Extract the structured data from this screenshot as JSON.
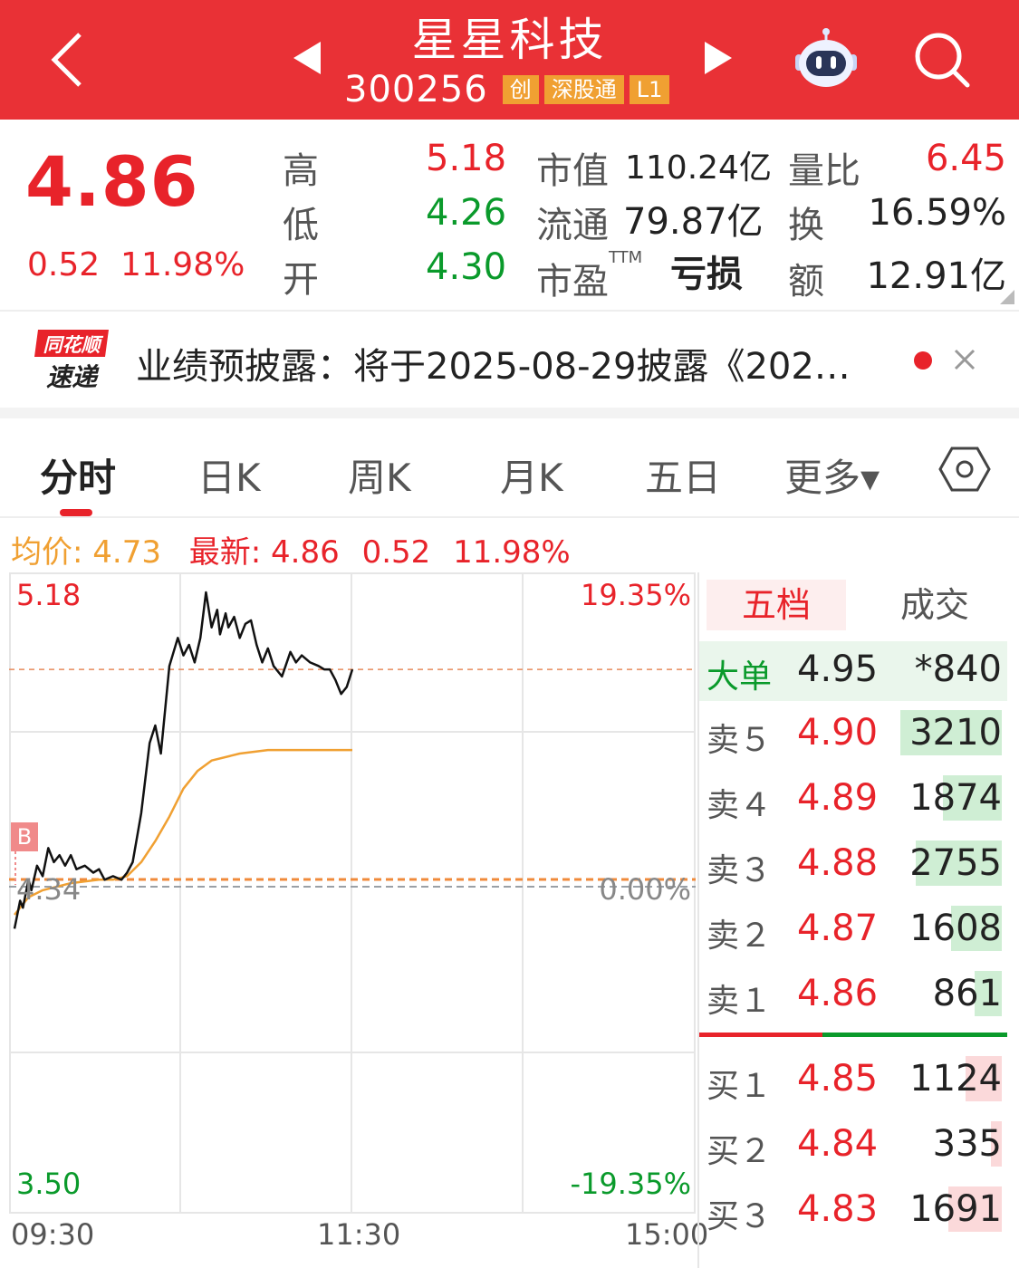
{
  "header": {
    "title": "星星科技",
    "code": "300256",
    "tags": [
      "创",
      "深股通",
      "L1"
    ],
    "icons": [
      "back-icon",
      "prev-stock-icon",
      "next-stock-icon",
      "robot-assistant-icon",
      "search-icon"
    ]
  },
  "quote": {
    "price": "4.86",
    "change": "0.52",
    "change_pct": "11.98%",
    "high_label": "高",
    "high": "5.18",
    "low_label": "低",
    "low": "4.26",
    "open_label": "开",
    "open": "4.30",
    "mktcap_label": "市值",
    "mktcap": "110.24亿",
    "float_label": "流通",
    "float": "79.87亿",
    "pe_label": "市盈",
    "pe_sup": "TTM",
    "pe": "亏损",
    "vol_ratio_label": "量比",
    "vol_ratio": "6.45",
    "turnover_label": "换",
    "turnover": "16.59%",
    "amount_label": "额",
    "amount": "12.91亿"
  },
  "news": {
    "logo_top": "同花顺",
    "logo_bottom": "速递",
    "text": "业绩预披露：将于2025-08-29披露《202…"
  },
  "tabs": [
    {
      "label": "分时",
      "active": true
    },
    {
      "label": "日K"
    },
    {
      "label": "周K"
    },
    {
      "label": "月K"
    },
    {
      "label": "五日"
    },
    {
      "label": "更多▾"
    }
  ],
  "summary": {
    "avg_label": "均价: 4.73",
    "latest_label": "最新: 4.86",
    "change": "0.52",
    "change_pct": "11.98%"
  },
  "chart_data": {
    "type": "line",
    "y_top": "5.18",
    "y_bottom": "3.50",
    "y_prev_close": "4.34",
    "pct_top": "19.35%",
    "pct_mid": "0.00%",
    "pct_bottom": "-19.35%",
    "marker": "B",
    "x_labels": [
      "09:30",
      "11:30",
      "15:00"
    ],
    "ylim": [
      3.5,
      5.18
    ],
    "prev_close": 4.34,
    "series": [
      {
        "name": "最新",
        "color": "#111111",
        "x": [
          0,
          2,
          3,
          5,
          6,
          8,
          10,
          12,
          14,
          16,
          18,
          20,
          22,
          25,
          28,
          30,
          32,
          35,
          38,
          40,
          42,
          45,
          48,
          50,
          52,
          55,
          58,
          60,
          62,
          64,
          66,
          68,
          70,
          72,
          73,
          75,
          76,
          78,
          80,
          82,
          84,
          86,
          88,
          90,
          92,
          95,
          98,
          100,
          102,
          105,
          108,
          110,
          112,
          114,
          116,
          118,
          120
        ],
        "y": [
          4.22,
          4.3,
          4.28,
          4.36,
          4.33,
          4.4,
          4.37,
          4.45,
          4.41,
          4.43,
          4.4,
          4.43,
          4.39,
          4.4,
          4.38,
          4.39,
          4.36,
          4.37,
          4.36,
          4.38,
          4.41,
          4.55,
          4.75,
          4.8,
          4.72,
          4.97,
          5.05,
          5.0,
          5.03,
          4.98,
          5.05,
          5.18,
          5.08,
          5.13,
          5.06,
          5.12,
          5.08,
          5.11,
          5.05,
          5.09,
          5.1,
          5.03,
          4.98,
          5.02,
          4.97,
          4.94,
          5.01,
          4.98,
          5.0,
          4.98,
          4.97,
          4.96,
          4.96,
          4.93,
          4.89,
          4.91,
          4.96
        ]
      },
      {
        "name": "均价",
        "color": "#f0a032",
        "x": [
          0,
          5,
          10,
          20,
          30,
          35,
          40,
          45,
          50,
          55,
          60,
          65,
          70,
          80,
          90,
          100,
          110,
          120
        ],
        "y": [
          4.26,
          4.31,
          4.33,
          4.35,
          4.36,
          4.36,
          4.37,
          4.41,
          4.47,
          4.54,
          4.62,
          4.67,
          4.7,
          4.72,
          4.73,
          4.73,
          4.73,
          4.73
        ]
      }
    ],
    "reference_line": {
      "name": "最新",
      "value": 4.96,
      "color": "#e88a5b"
    }
  },
  "orderbook": {
    "tab_active": "五档",
    "tab_other": "成交",
    "big_order": {
      "label": "大单",
      "price": "4.95",
      "vol": "*840"
    },
    "asks": [
      {
        "label": "卖５",
        "price": "4.90",
        "vol": "3210",
        "bar": 0.93
      },
      {
        "label": "卖４",
        "price": "4.89",
        "vol": "1874",
        "bar": 0.54
      },
      {
        "label": "卖３",
        "price": "4.88",
        "vol": "2755",
        "bar": 0.79
      },
      {
        "label": "卖２",
        "price": "4.87",
        "vol": "1608",
        "bar": 0.47
      },
      {
        "label": "卖１",
        "price": "4.86",
        "vol": "861",
        "bar": 0.25
      }
    ],
    "bids": [
      {
        "label": "买１",
        "price": "4.85",
        "vol": "1124",
        "bar": 0.33
      },
      {
        "label": "买２",
        "price": "4.84",
        "vol": "335",
        "bar": 0.1
      },
      {
        "label": "买３",
        "price": "4.83",
        "vol": "1691",
        "bar": 0.49
      }
    ],
    "split_ratio": 0.4,
    "colors": {
      "red": "#e8232a",
      "green": "#0a9a2b"
    }
  }
}
